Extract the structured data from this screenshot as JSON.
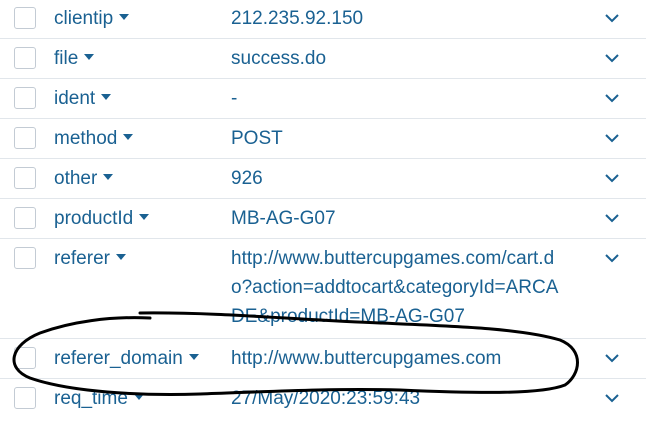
{
  "fields": [
    {
      "name": "clientip",
      "value": "212.235.92.150"
    },
    {
      "name": "file",
      "value": "success.do"
    },
    {
      "name": "ident",
      "value": "-"
    },
    {
      "name": "method",
      "value": "POST"
    },
    {
      "name": "other",
      "value": "926"
    },
    {
      "name": "productId",
      "value": "MB-AG-G07"
    },
    {
      "name": "referer",
      "value": "http://www.buttercupgames.com/cart.do?action=addtocart&categoryId=ARCADE&productId=MB-AG-G07"
    },
    {
      "name": "referer_domain",
      "value": "http://www.buttercupgames.com"
    },
    {
      "name": "req_time",
      "value": "27/May/2020:23:59:43"
    }
  ],
  "icons": {
    "caret": "caret-down-icon",
    "expand": "chevron-down-icon"
  },
  "colors": {
    "link": "#1a6192",
    "border": "#e1e6eb",
    "annotation": "#000000"
  }
}
